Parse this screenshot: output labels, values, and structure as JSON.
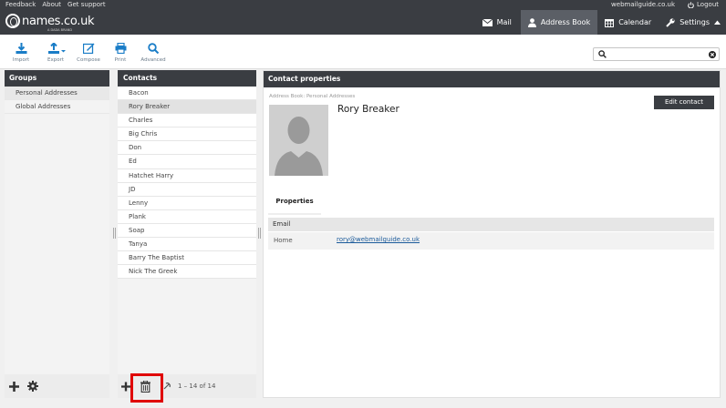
{
  "topbar": {
    "feedback": "Feedback",
    "about": "About",
    "support": "Get support",
    "domain": "webmailguide.co.uk",
    "logout": "Logout"
  },
  "header": {
    "logo": "names.co.uk",
    "logo_sub": "A DADA BRAND",
    "nav": [
      {
        "label": "Mail",
        "icon": "mail-icon"
      },
      {
        "label": "Address Book",
        "icon": "person-icon",
        "active": true
      },
      {
        "label": "Calendar",
        "icon": "calendar-icon"
      },
      {
        "label": "Settings",
        "icon": "wrench-icon"
      }
    ]
  },
  "toolbar": {
    "import": "Import",
    "export": "Export",
    "compose": "Compose",
    "print": "Print",
    "advanced": "Advanced",
    "search_placeholder": ""
  },
  "groups": {
    "title": "Groups",
    "items": [
      "Personal Addresses",
      "Global Addresses"
    ],
    "selected": 0
  },
  "contacts": {
    "title": "Contacts",
    "items": [
      "Bacon",
      "Rory Breaker",
      "Charles",
      "Big Chris",
      "Don",
      "Ed",
      "Hatchet Harry",
      "JD",
      "Lenny",
      "Plank",
      "Soap",
      "Tanya",
      "Barry The Baptist",
      "Nick The Greek"
    ],
    "selected": 1,
    "count": "1 – 14 of 14"
  },
  "properties": {
    "title": "Contact properties",
    "address_book": "Address Book: Personal Addresses",
    "name": "Rory Breaker",
    "edit_label": "Edit contact",
    "tab": "Properties",
    "section": "Email",
    "field_label": "Home",
    "email": "rory@webmailguide.co.uk"
  },
  "colors": {
    "dark": "#3a3d42",
    "accent": "#1a7dc7",
    "highlight": "#e00000"
  }
}
